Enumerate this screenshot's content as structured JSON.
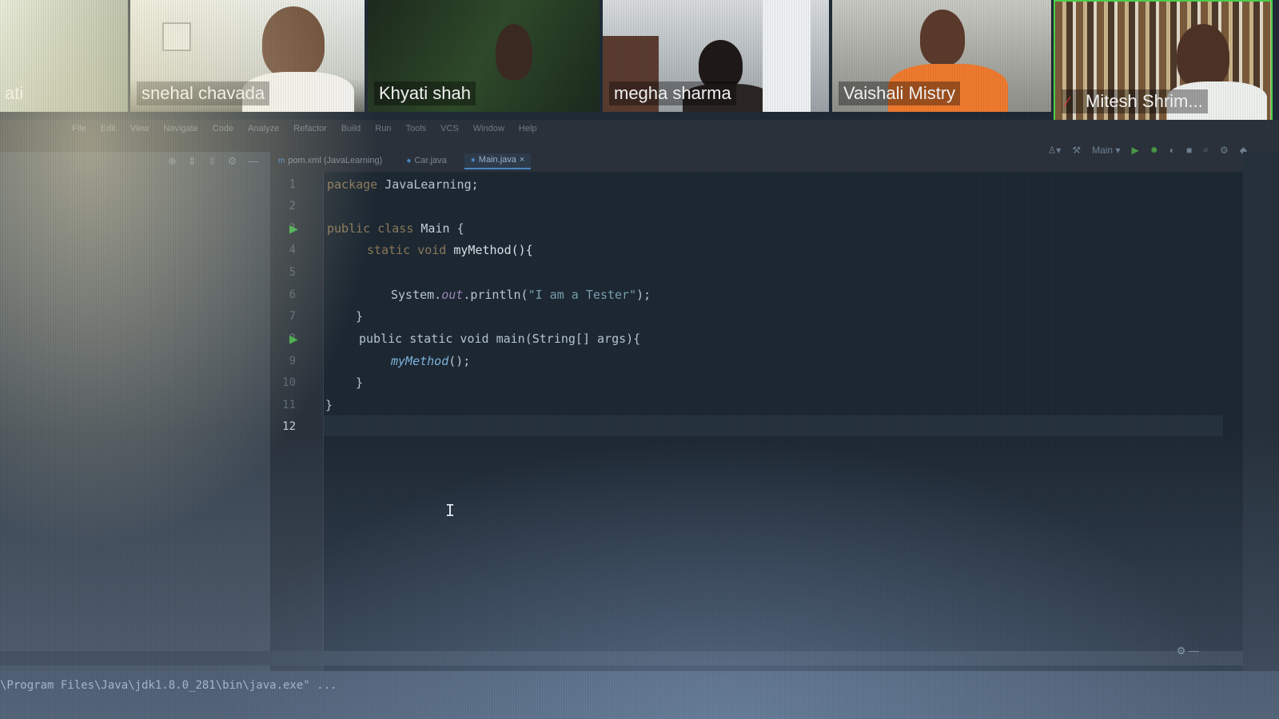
{
  "participants": [
    {
      "name": "ati"
    },
    {
      "name": "snehal chavada"
    },
    {
      "name": "Khyati shah"
    },
    {
      "name": "megha sharma"
    },
    {
      "name": "Vaishali Mistry"
    },
    {
      "name": "Mitesh Shrim...",
      "muted": true
    }
  ],
  "ide": {
    "menu": [
      "File",
      "Edit",
      "View",
      "Navigate",
      "Code",
      "Analyze",
      "Refactor",
      "Build",
      "Run",
      "Tools",
      "VCS",
      "Window",
      "Help"
    ],
    "tabs": [
      {
        "label": "pom.xml (JavaLearning)",
        "active": false
      },
      {
        "label": "Car.java",
        "active": false
      },
      {
        "label": "Main.java",
        "active": true
      }
    ],
    "run_config": "Main",
    "line_numbers": [
      "1",
      "2",
      "3",
      "4",
      "5",
      "6",
      "7",
      "8",
      "9",
      "10",
      "11",
      "12"
    ],
    "code": {
      "l1_kw": "package",
      "l1_rest": "JavaLearning;",
      "l3_kw": "public class",
      "l3_cls": "Main",
      "l3_brace": "{",
      "l4_kw": "static void",
      "l4_fn": "myMethod(){",
      "l6_a": "System.",
      "l6_field": "out",
      "l6_b": ".println(",
      "l6_str": "\"I am a Tester\"",
      "l6_c": ");",
      "l7": "}",
      "l8": "public static void main(String[] args){",
      "l9_call": "myMethod",
      "l9_rest": "();",
      "l10": "}",
      "l11": "}"
    },
    "console_text": "\\Program Files\\Java\\jdk1.8.0_281\\bin\\java.exe\" ..."
  },
  "colors": {
    "editor_bg": "#1d2833",
    "active_speaker_border": "#4bd14b",
    "run_arrow": "#3fae4a",
    "mute_icon": "#e03a3a"
  }
}
